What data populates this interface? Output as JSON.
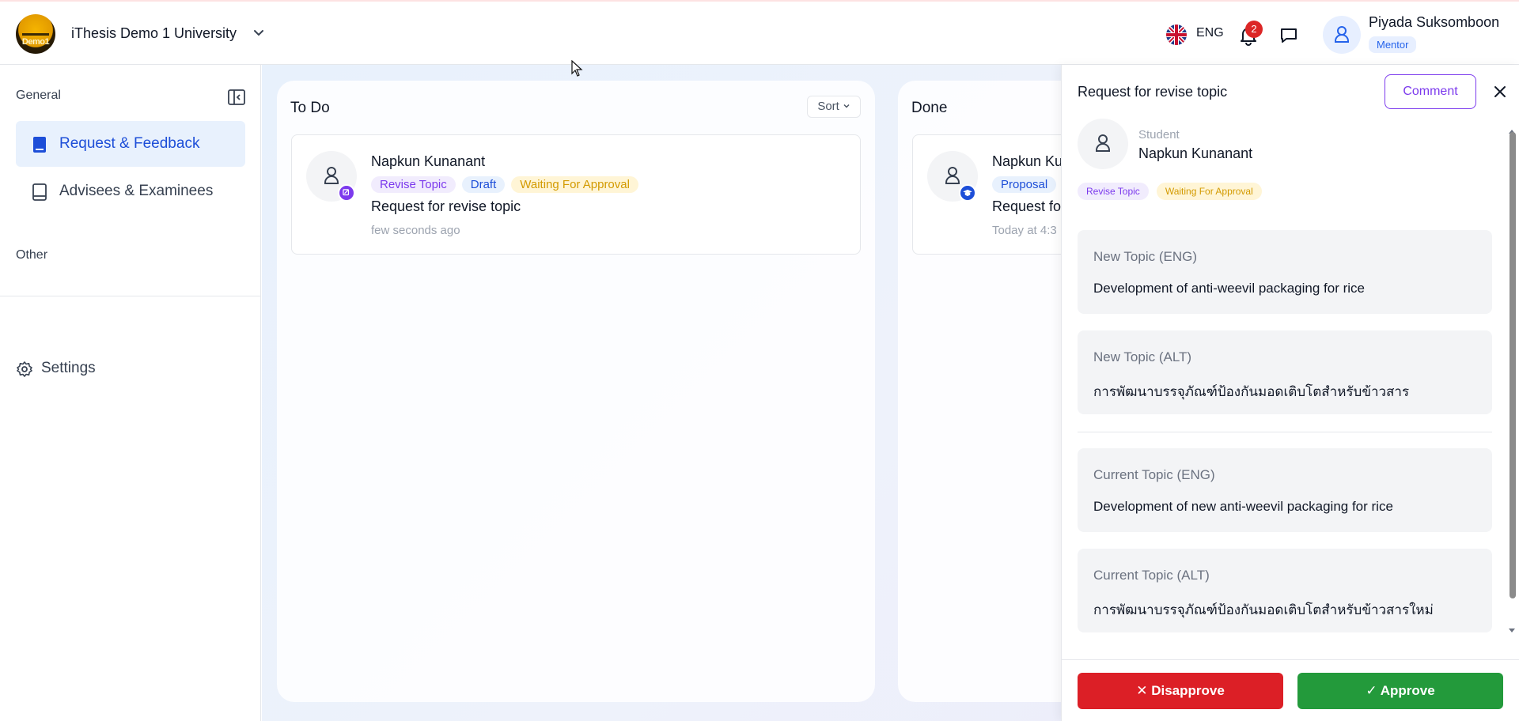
{
  "header": {
    "university": "iThesis Demo 1 University",
    "logo_text": "Demo1",
    "language": "ENG",
    "notification_count": "2",
    "user": {
      "name": "Piyada Suksomboon",
      "role": "Mentor"
    }
  },
  "sidebar": {
    "section_general": "General",
    "items": [
      {
        "label": "Request & Feedback",
        "icon": "book-icon",
        "active": true
      },
      {
        "label": "Advisees & Examinees",
        "icon": "notebook-icon",
        "active": false
      }
    ],
    "section_other": "Other",
    "settings_label": "Settings"
  },
  "board": {
    "todo": {
      "title": "To Do",
      "sort_label": "Sort",
      "card": {
        "name": "Napkun Kunanant",
        "tags": [
          "Revise Topic",
          "Draft",
          "Waiting For Approval"
        ],
        "title": "Request for revise topic",
        "time": "few seconds ago"
      }
    },
    "done": {
      "title": "Done",
      "card": {
        "name": "Napkun Ku",
        "tags": [
          "Proposal"
        ],
        "title": "Request fo",
        "time": "Today at 4:3"
      }
    }
  },
  "panel": {
    "title": "Request for revise topic",
    "comment_label": "Comment",
    "student_label": "Student",
    "student_name": "Napkun Kunanant",
    "tags": [
      "Revise Topic",
      "Waiting For Approval"
    ],
    "topics": [
      {
        "label": "New Topic (ENG)",
        "value": "Development of anti-weevil packaging for rice"
      },
      {
        "label": "New Topic (ALT)",
        "value": "การพัฒนาบรรจุภัณฑ์ป้องกันมอดเติบโตสำหรับข้าวสาร"
      },
      {
        "label": "Current Topic (ENG)",
        "value": "Development of new anti-weevil packaging for rice"
      },
      {
        "label": "Current Topic (ALT)",
        "value": "การพัฒนาบรรจุภัณฑ์ป้องกันมอดเติบโตสำหรับข้าวสารใหม่"
      }
    ],
    "disapprove_label": "Disapprove",
    "approve_label": "Approve"
  },
  "colors": {
    "primary": "#1d4ed8",
    "purple": "#7c3aed",
    "danger": "#dc1f26",
    "success": "#239a3b",
    "warning": "#d39a00"
  }
}
